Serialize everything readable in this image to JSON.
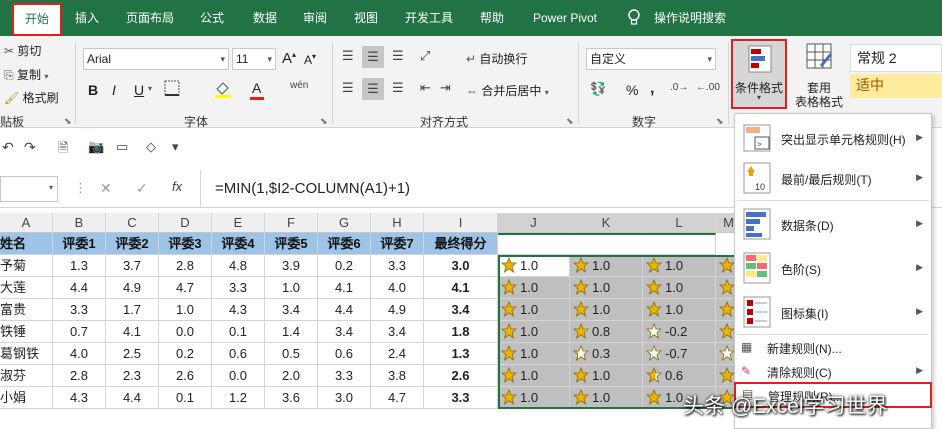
{
  "tabs": [
    "开始",
    "插入",
    "页面布局",
    "公式",
    "数据",
    "审阅",
    "视图",
    "开发工具",
    "帮助",
    "Power Pivot",
    "操作说明搜索"
  ],
  "clipboard": {
    "cut": "剪切",
    "copy": "复制",
    "format_painter": "格式刷",
    "group_label": "贴板"
  },
  "font": {
    "name": "Arial",
    "size": "11",
    "group_label": "字体",
    "inc": "A",
    "dec": "A",
    "bold": "B",
    "italic": "I",
    "underline": "U",
    "wen": "wén"
  },
  "alignment": {
    "wrap": "自动换行",
    "merge": "合并后居中",
    "group_label": "对齐方式"
  },
  "number": {
    "format": "自定义",
    "percent": "%",
    "comma": ",",
    "group_label": "数字"
  },
  "styles": {
    "cond_format": "条件格式",
    "table_format_1": "套用",
    "table_format_2": "表格格式",
    "style_normal2": "常规 2",
    "style_neutral": "适中"
  },
  "formula_bar": {
    "name_box": "",
    "fx": "fx",
    "formula": "=MIN(1,$I2-COLUMN(A1)+1)"
  },
  "columns": [
    "A",
    "B",
    "C",
    "D",
    "E",
    "F",
    "G",
    "H",
    "I",
    "J",
    "K",
    "L",
    "M"
  ],
  "table": {
    "headers": [
      "姓名",
      "评委1",
      "评委2",
      "评委3",
      "评委4",
      "评委5",
      "评委6",
      "评委7",
      "最终得分"
    ],
    "rows": [
      {
        "name": "予菊",
        "scores": [
          "1.3",
          "3.7",
          "2.8",
          "4.8",
          "3.9",
          "0.2",
          "3.3"
        ],
        "final": "3.0",
        "j": "1.0",
        "k": "1.0",
        "l": "1.0"
      },
      {
        "name": "大莲",
        "scores": [
          "4.4",
          "4.9",
          "4.7",
          "3.3",
          "1.0",
          "4.1",
          "4.0"
        ],
        "final": "4.1",
        "j": "1.0",
        "k": "1.0",
        "l": "1.0"
      },
      {
        "name": "富贵",
        "scores": [
          "3.3",
          "1.7",
          "1.0",
          "4.3",
          "3.4",
          "4.4",
          "4.9"
        ],
        "final": "3.4",
        "j": "1.0",
        "k": "1.0",
        "l": "1.0"
      },
      {
        "name": "铁锤",
        "scores": [
          "0.7",
          "4.1",
          "0.0",
          "0.1",
          "1.4",
          "3.4",
          "3.4"
        ],
        "final": "1.8",
        "j": "1.0",
        "k": "0.8",
        "l": "-0.2"
      },
      {
        "name": "葛钢铁",
        "scores": [
          "4.0",
          "2.5",
          "0.2",
          "0.6",
          "0.5",
          "0.6",
          "2.4"
        ],
        "final": "1.3",
        "j": "1.0",
        "k": "0.3",
        "l": "-0.7"
      },
      {
        "name": "淑芬",
        "scores": [
          "2.8",
          "2.3",
          "2.6",
          "0.0",
          "2.0",
          "3.3",
          "3.8"
        ],
        "final": "2.6",
        "j": "1.0",
        "k": "1.0",
        "l": "0.6"
      },
      {
        "name": "小娟",
        "scores": [
          "4.3",
          "4.4",
          "0.1",
          "1.2",
          "3.6",
          "3.0",
          "4.7"
        ],
        "final": "3.3",
        "j": "1.0",
        "k": "1.0",
        "l": "1.0"
      }
    ]
  },
  "menu": {
    "items": [
      {
        "label": "突出显示单元格规则(H)",
        "submenu": true
      },
      {
        "label": "最前/最后规则(T)",
        "submenu": true
      },
      {
        "label": "数据条(D)",
        "submenu": true
      },
      {
        "label": "色阶(S)",
        "submenu": true
      },
      {
        "label": "图标集(I)",
        "submenu": true
      }
    ],
    "new_rule": "新建规则(N)...",
    "clear_rule": "清除规则(C)",
    "manage_rule": "管理规则(R)..."
  },
  "watermark": "头条 @Excel学习世界",
  "colors": {
    "tab_green": "#217346",
    "header_blue": "#9dc3e6",
    "highlight_red": "#e02020",
    "star_gold": "#f0b400",
    "neutral_yellow": "#ffeb9c"
  }
}
